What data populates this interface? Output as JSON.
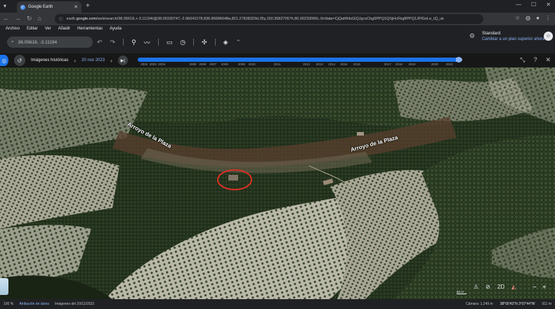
{
  "browser": {
    "tab_title": "Google Earth",
    "url_prefix": "earth.",
    "url_domain": "google.com",
    "url_rest": "/web/search/38.05618,+-3.11194/@38.06330747,-2.96041078,836.86686648a,821.27838329d,35y,150.35827057h,80.00233066t,-0r/data=CjQaMhIsGiQJgcsCbg5PPQ1QSjHcFbg8PPQ1JFfGeLe_tQ_uk"
  },
  "menu": [
    "Archivo",
    "Editar",
    "Ver",
    "Añadir",
    "Herramientas",
    "Ayuda"
  ],
  "search": {
    "value": "38.05618, -3.11194"
  },
  "plan": {
    "title": "Standard",
    "subtitle": "Cambiar a un plan superior ahora"
  },
  "history": {
    "label": "Imágenes históricas",
    "date": "20 nov 2023",
    "years": [
      "2002",
      "2003",
      "2004",
      "2005",
      "2006",
      "2007",
      "2008",
      "2009",
      "2010",
      "2011",
      "2012",
      "2013",
      "2014",
      "2015",
      "2016",
      "2017",
      "2018",
      "2019",
      "2020",
      "2023"
    ],
    "year_positions": [
      0.02,
      0.047,
      0.074,
      0.17,
      0.2,
      0.232,
      0.268,
      0.32,
      0.352,
      0.43,
      0.52,
      0.56,
      0.598,
      0.635,
      0.675,
      0.77,
      0.805,
      0.845,
      0.915,
      0.96
    ],
    "progress": 0.99
  },
  "map": {
    "labels": [
      "Arroyo de la Plaza",
      "Arroyo de la Plaza"
    ],
    "scale": "60 m",
    "compass_value": "2D"
  },
  "status": {
    "zoom": "100 %",
    "attribution": "Atribución de datos",
    "source_date": "Imágenes del 20/11/2023",
    "camera": "Cámara: 1.249 m",
    "coords": "38°00'43\"N 3°07'44\"W",
    "elevation": "911 m"
  },
  "colors": {
    "accent": "#1a73e8",
    "link": "#8ab4f8",
    "marker": "#d93025"
  }
}
